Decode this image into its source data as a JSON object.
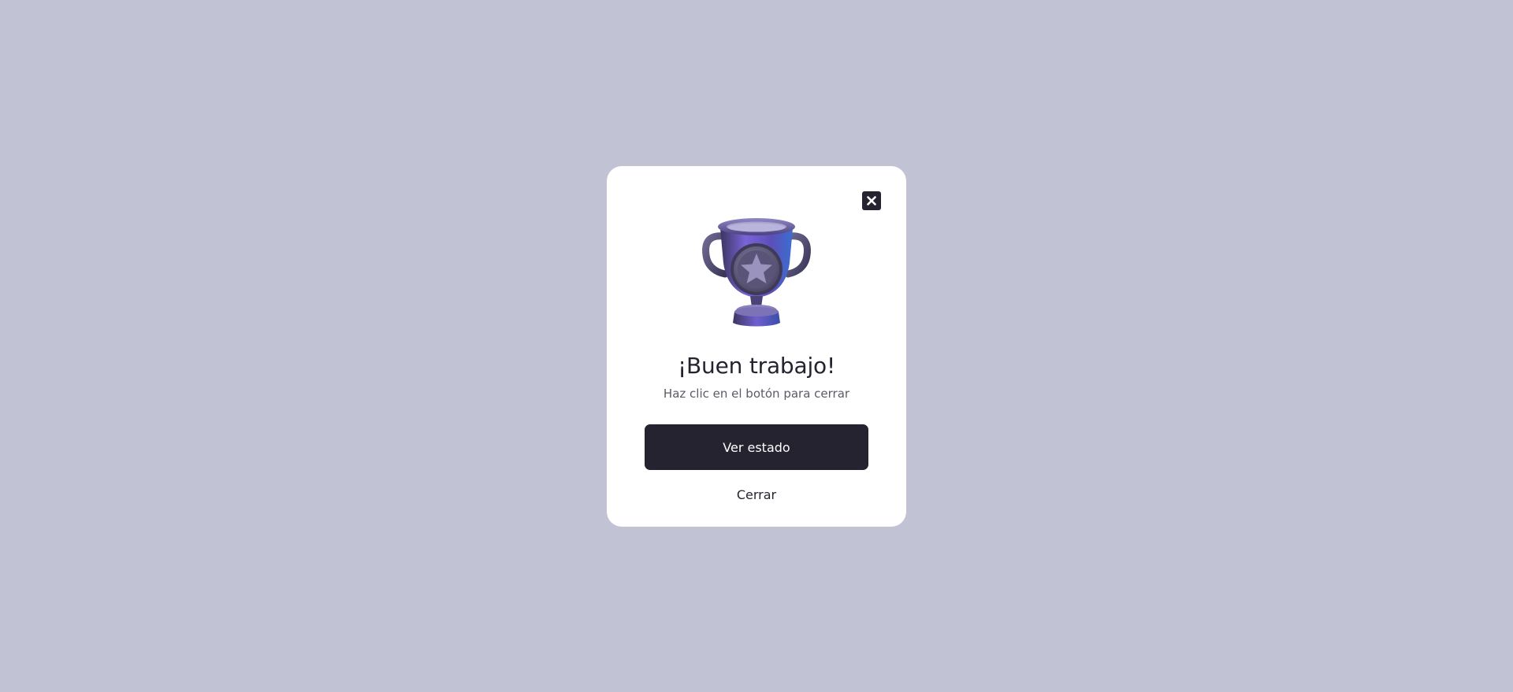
{
  "modal": {
    "title": "¡Buen trabajo!",
    "subtitle": "Haz clic en el botón para cerrar",
    "primary_button_label": "Ver estado",
    "secondary_button_label": "Cerrar",
    "close_icon": "close-x-icon",
    "illustration": "trophy-star-icon"
  },
  "colors": {
    "background": "#c1c3d5",
    "card": "#ffffff",
    "primary": "#25232f",
    "subtitle_text": "#5c5a66",
    "trophy_body": "#6a5acd"
  }
}
